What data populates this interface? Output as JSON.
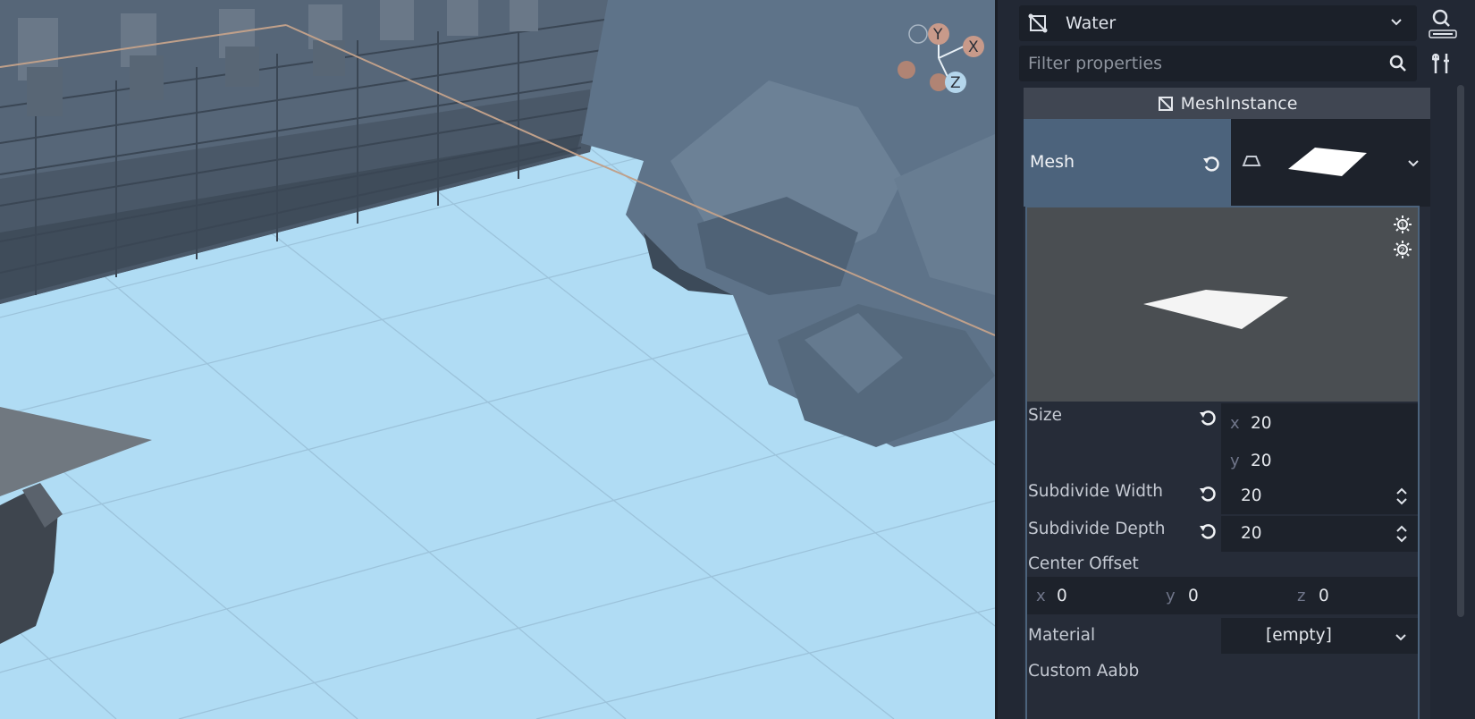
{
  "viewport": {
    "gizmo": {
      "y_label": "Y",
      "x_label": "X",
      "z_label": "Z"
    }
  },
  "inspector": {
    "node_name": "Water",
    "filter_placeholder": "Filter properties",
    "section_title": "MeshInstance",
    "mesh_label": "Mesh",
    "properties": {
      "size_label": "Size",
      "size_x_axis": "x",
      "size_x": "20",
      "size_y_axis": "y",
      "size_y": "20",
      "subdivide_width_label": "Subdivide Width",
      "subdivide_width": "20",
      "subdivide_depth_label": "Subdivide Depth",
      "subdivide_depth": "20",
      "center_offset_label": "Center Offset",
      "co_x_axis": "x",
      "co_x": "0",
      "co_y_axis": "y",
      "co_y": "0",
      "co_z_axis": "z",
      "co_z": "0",
      "material_label": "Material",
      "material_value": "[empty]",
      "custom_aabb_label": "Custom Aabb"
    }
  },
  "icons": {
    "node": "mesh-instance-icon",
    "doc": "doc-search-icon",
    "search": "search-icon",
    "tools": "object-tools-icon",
    "revert": "revert-icon",
    "light": "light-toggle-icon"
  },
  "colors": {
    "water": "#b0dcf4",
    "inspector_bg": "#222834",
    "highlight": "#4c637c",
    "field_bg": "#1d222b"
  }
}
